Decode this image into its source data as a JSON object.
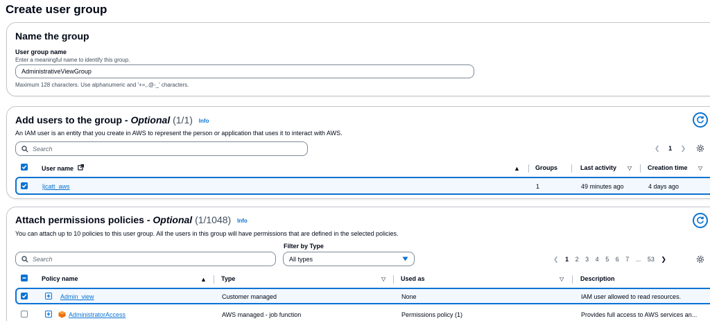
{
  "page": {
    "title": "Create user group"
  },
  "name_section": {
    "title": "Name the group",
    "field_label": "User group name",
    "field_description": "Enter a meaningful name to identify this group.",
    "field_value": "AdministrativeViewGroup",
    "constraint": "Maximum 128 characters. Use alphanumeric and '+=,.@-_' characters."
  },
  "users_section": {
    "title": "Add users to the group",
    "optional": "- Optional",
    "count": "(1/1)",
    "info": "Info",
    "description": "An IAM user is an entity that you create in AWS to represent the person or application that uses it to interact with AWS.",
    "search_placeholder": "Search",
    "pagination": {
      "current": "1"
    },
    "columns": [
      "User name",
      "Groups",
      "Last activity",
      "Creation time"
    ],
    "rows": [
      {
        "name": "ljcatt_aws",
        "groups": "1",
        "last_activity": "49 minutes ago",
        "creation_time": "4 days ago",
        "selected": true
      }
    ]
  },
  "policies_section": {
    "title": "Attach permissions policies",
    "optional": "- Optional",
    "count": "(1/1048)",
    "info": "Info",
    "description": "You can attach up to 10 policies to this user group. All the users in this group will have permissions that are defined in the selected policies.",
    "filter_label": "Filter by Type",
    "filter_value": "All types",
    "search_placeholder": "Search",
    "pagination": {
      "pages": [
        "1",
        "2",
        "3",
        "4",
        "5",
        "6",
        "7"
      ],
      "ellipsis": "...",
      "last": "53",
      "current": "1"
    },
    "columns": [
      "Policy name",
      "Type",
      "Used as",
      "Description"
    ],
    "rows": [
      {
        "name": "Admin_view",
        "type": "Customer managed",
        "used_as": "None",
        "description": "IAM user allowed to read resources.",
        "selected": true,
        "aws_icon": false
      },
      {
        "name": "AdministratorAccess",
        "type": "AWS managed - job function",
        "used_as": "Permissions policy (1)",
        "description": "Provides full access to AWS services an...",
        "selected": false,
        "aws_icon": true
      }
    ]
  },
  "colors": {
    "accent": "#0972d3",
    "text": "#000716",
    "border": "#c6c6cd",
    "aws_orange": "#ec7211"
  }
}
